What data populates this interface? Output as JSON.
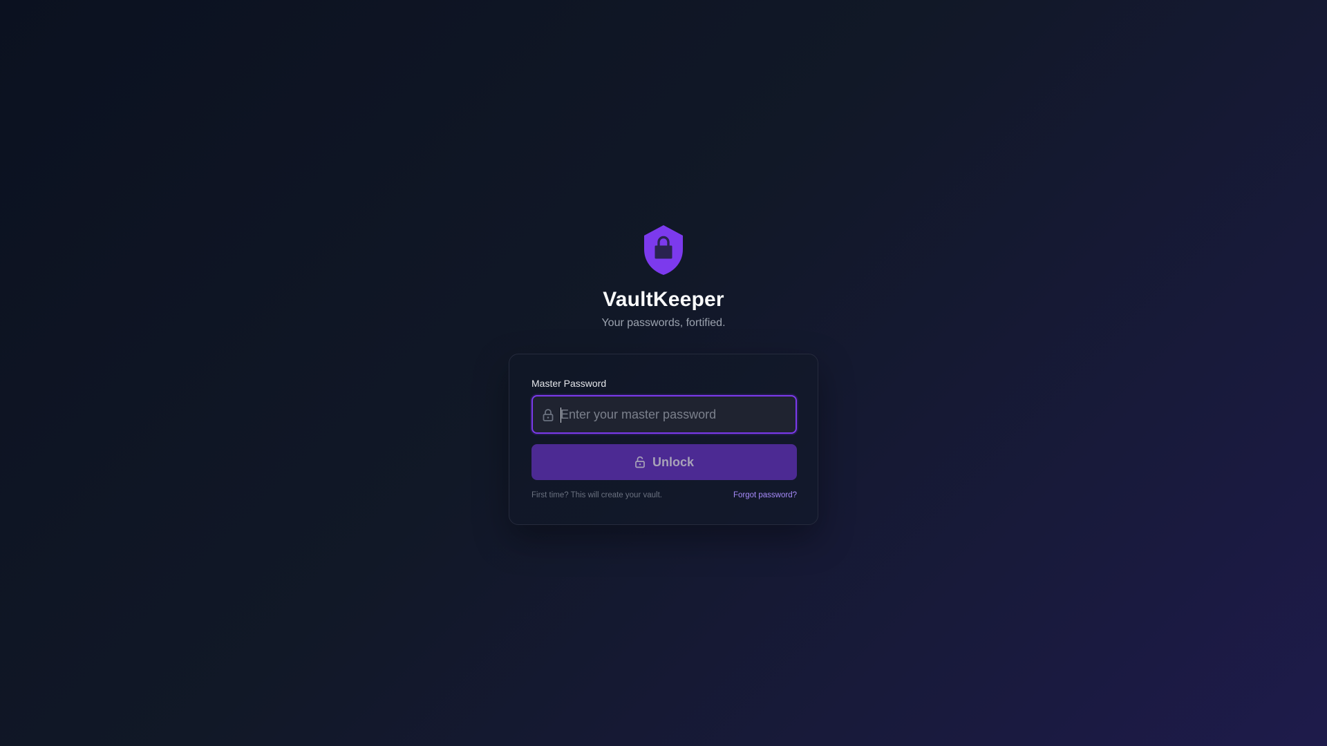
{
  "app": {
    "title": "VaultKeeper",
    "subtitle": "Your passwords, fortified.",
    "logo_icon": "shield-lock-icon"
  },
  "login": {
    "label": "Master Password",
    "value": "",
    "placeholder": "Enter your master password",
    "input_icon": "lock-icon",
    "unlock_label": "Unlock",
    "unlock_icon": "unlock-icon",
    "note": "First time? This will create your vault.",
    "forgot_label": "Forgot password?"
  },
  "colors": {
    "accent": "#7c3aed",
    "button_bg": "#4c2a93",
    "link": "#a78bfa",
    "background_start": "#0b1120",
    "background_end": "#1e1b4b"
  }
}
